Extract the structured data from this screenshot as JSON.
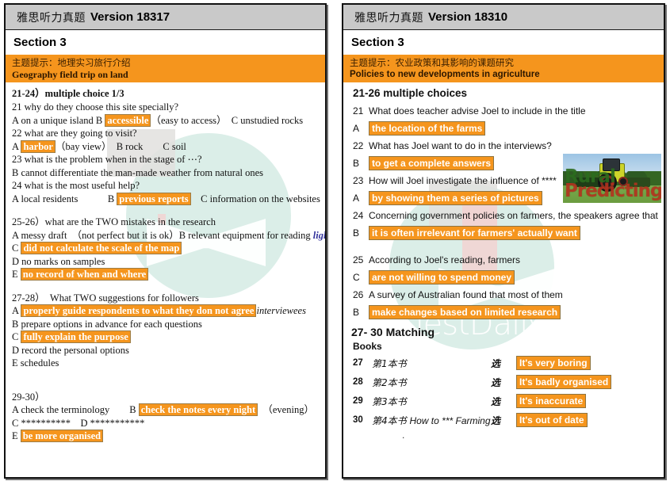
{
  "left": {
    "title_cn": "雅思听力真题",
    "title_en": "Version 18317",
    "section": "Section 3",
    "topic_cn": "主题提示：地理实习旅行介绍",
    "topic_en": "Geography field trip on land",
    "q2124_head": "21-24）multiple choice 1/3",
    "q21": "21 why do they choose this site specially?",
    "q21_a_pre": "A on a unique island B ",
    "q21_hl": "accessible",
    "q21_a_post": "（easy to access）　C unstudied rocks",
    "q22": "22 what are they going to visit?",
    "q22_pre": "A ",
    "q22_hl": "harbor",
    "q22_post": "（bay view）　B rock　　C soil",
    "q23": "23 what is the problem when in the stage of ⋯?",
    "q23_b": "B cannot differentiate the man-made weather from natural ones",
    "q24": "24 what is the most useful help?",
    "q24_pre": "A local residents　　　B ",
    "q24_hl": "previous reports",
    "q24_post": "　C information on the websites",
    "q2526_head": "25-26）what are the TWO mistakes in the research",
    "q2526_a_pre": "A messy draft　（not perfect but it is ok）B relevant equipment for reading ",
    "q2526_a_ital": "lighting",
    "q2526_c_pre": "C ",
    "q2526_c_hl": "did not calculate the scale of the map",
    "q2526_d": "D no marks on samples",
    "q2526_e_pre": "E ",
    "q2526_e_hl": "no record of when and where",
    "q2728_head": "27-28）　What TWO suggestions for followers",
    "q2728_a_pre": "A ",
    "q2728_a_hl": "properly guide respondents to what they don not agree",
    "q2728_a_ital": "interviewees",
    "q2728_b": "B prepare options in advance for each questions",
    "q2728_c_pre": "C ",
    "q2728_c_hl": "fully explain the purpose",
    "q2728_d": "D record the personal options",
    "q2728_e": "E schedules",
    "q2930_head": "29-30）",
    "q2930_a_pre": "A check the terminology　　B ",
    "q2930_a_hl": "check the notes every night",
    "q2930_a_post": "　（evening）",
    "q2930_cd": "C **********　D ***********",
    "q2930_e_pre": "E ",
    "q2930_e_hl": "be more organised"
  },
  "right": {
    "title_cn": "雅思听力真题",
    "title_en": "Version 18310",
    "section": "Section 3",
    "topic_cn": "主题提示：农业政策和其影响的课题研究",
    "topic_en": "Policies to new developments in agriculture",
    "mc_head": "21-26 multiple choices",
    "questions": [
      {
        "num": "21",
        "text": "What does teacher advise Joel to include in the title",
        "opt": "A",
        "answer": "the location of the farms"
      },
      {
        "num": "22",
        "text": "What has Joel want to do in the interviews?",
        "opt": "B",
        "answer": "to get a complete answers"
      },
      {
        "num": "23",
        "text": "How will Joel investigate the influence of ****",
        "opt": "A",
        "answer": "by showing them a series of pictures"
      },
      {
        "num": "24",
        "text": "Concerning government policies on farmers, the speakers agree that",
        "opt": "B",
        "answer": "it is often irrelevant for farmers' actually want"
      },
      {
        "num": "25",
        "text": "According to Joel's reading, farmers",
        "opt": "C",
        "answer": "are not willing to spend money"
      },
      {
        "num": "26",
        "text": "A survey of Australian found that most of them",
        "opt": "B",
        "answer": "make changes based on limited research"
      }
    ],
    "match_head": "27- 30 Matching",
    "books_label": "Books",
    "matches": [
      {
        "num": "27",
        "book": "第1本书",
        "book_en": "",
        "pick": "选",
        "answer": "It's very boring"
      },
      {
        "num": "28",
        "book": "第2本书",
        "book_en": "",
        "pick": "选",
        "answer": "It's badly organised"
      },
      {
        "num": "29",
        "book": "第3本书",
        "book_en": "",
        "pick": "选",
        "answer": "It's inaccurate"
      },
      {
        "num": "30",
        "book": "第4本书",
        "book_en": "How to *** Farming",
        "pick": "选",
        "answer": "It's out of date"
      }
    ],
    "trailing_dot": ".",
    "photo_overlay_1": "Rural",
    "photo_overlay_2": "Predicting"
  },
  "watermark": {
    "text": "TestDaily",
    "circle_color": "#d9ede7",
    "accent_color": "#f5951d"
  }
}
